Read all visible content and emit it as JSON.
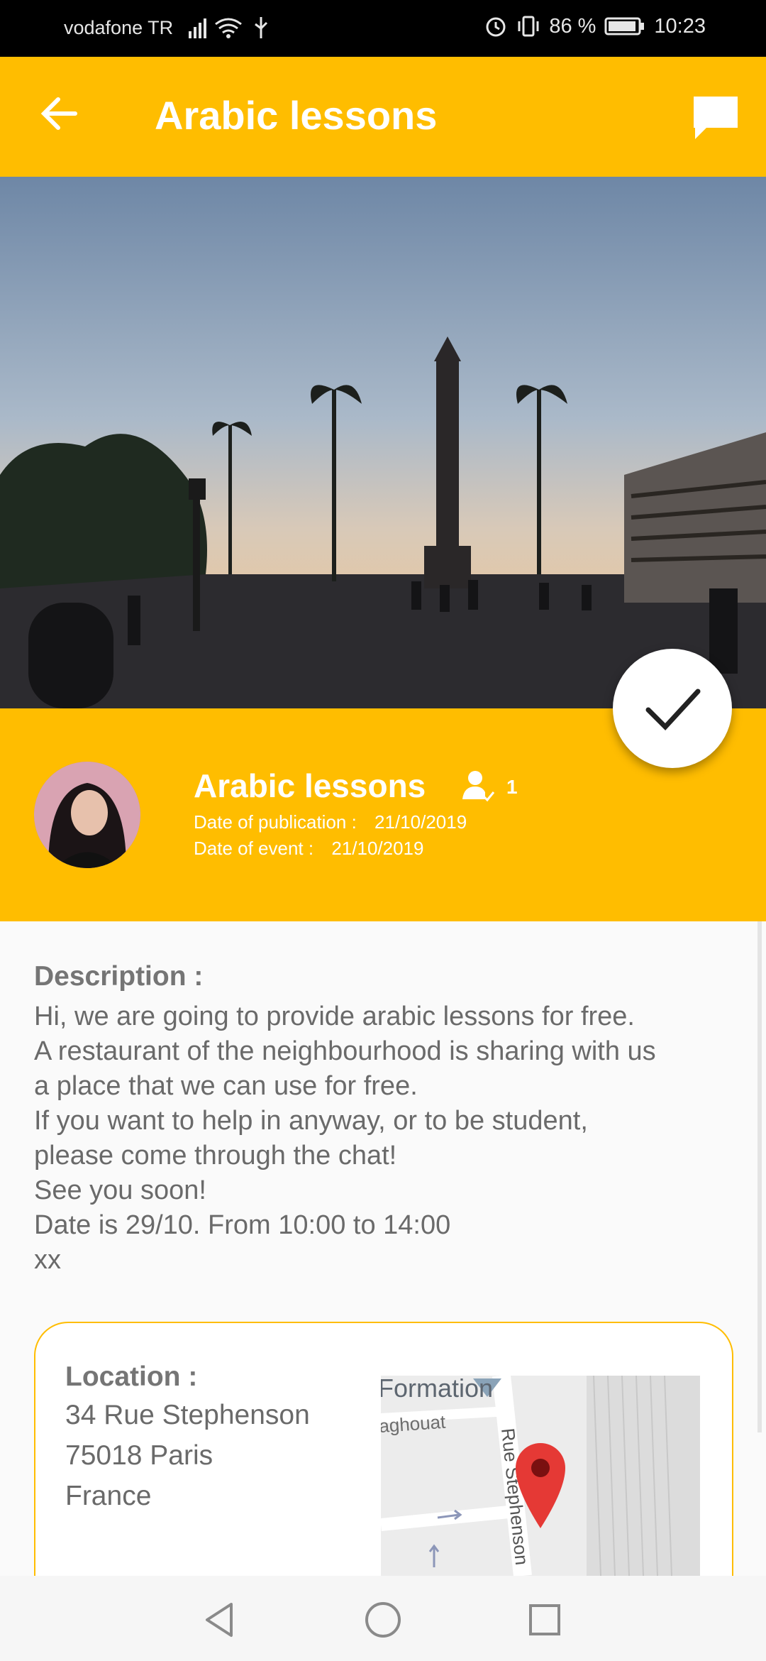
{
  "status_bar": {
    "carrier": "vodafone TR",
    "battery": "86 %",
    "time": "10:23"
  },
  "app_bar": {
    "title": "Arabic lessons"
  },
  "event": {
    "title": "Arabic lessons",
    "participants": "1",
    "publication_label": "Date of publication :",
    "publication_date": "21/10/2019",
    "event_label": "Date of event :",
    "event_date": "21/10/2019"
  },
  "description": {
    "label": "Description :",
    "text": "Hi, we are going to provide arabic lessons for free.\nA restaurant of the neighbourhood is sharing with us\na place that we can use for free.\nIf you want to help in anyway, or to be student,\nplease come through the chat!\nSee you soon!\nDate is 29/10. From 10:00 to 14:00\nxx"
  },
  "location": {
    "label": "Location :",
    "street": "34 Rue Stephenson",
    "city": "75018 Paris",
    "country": "France",
    "map_labels": {
      "place": "Formation",
      "street_partial": "aghouat",
      "street_vertical": "Rue Stephenson"
    }
  },
  "icons": {
    "back": "arrow-left-icon",
    "chat": "chat-bubble-icon",
    "participants": "person-check-icon",
    "check": "check-icon"
  },
  "colors": {
    "accent": "#ffbd00",
    "text_gray": "#6a6a6a"
  }
}
